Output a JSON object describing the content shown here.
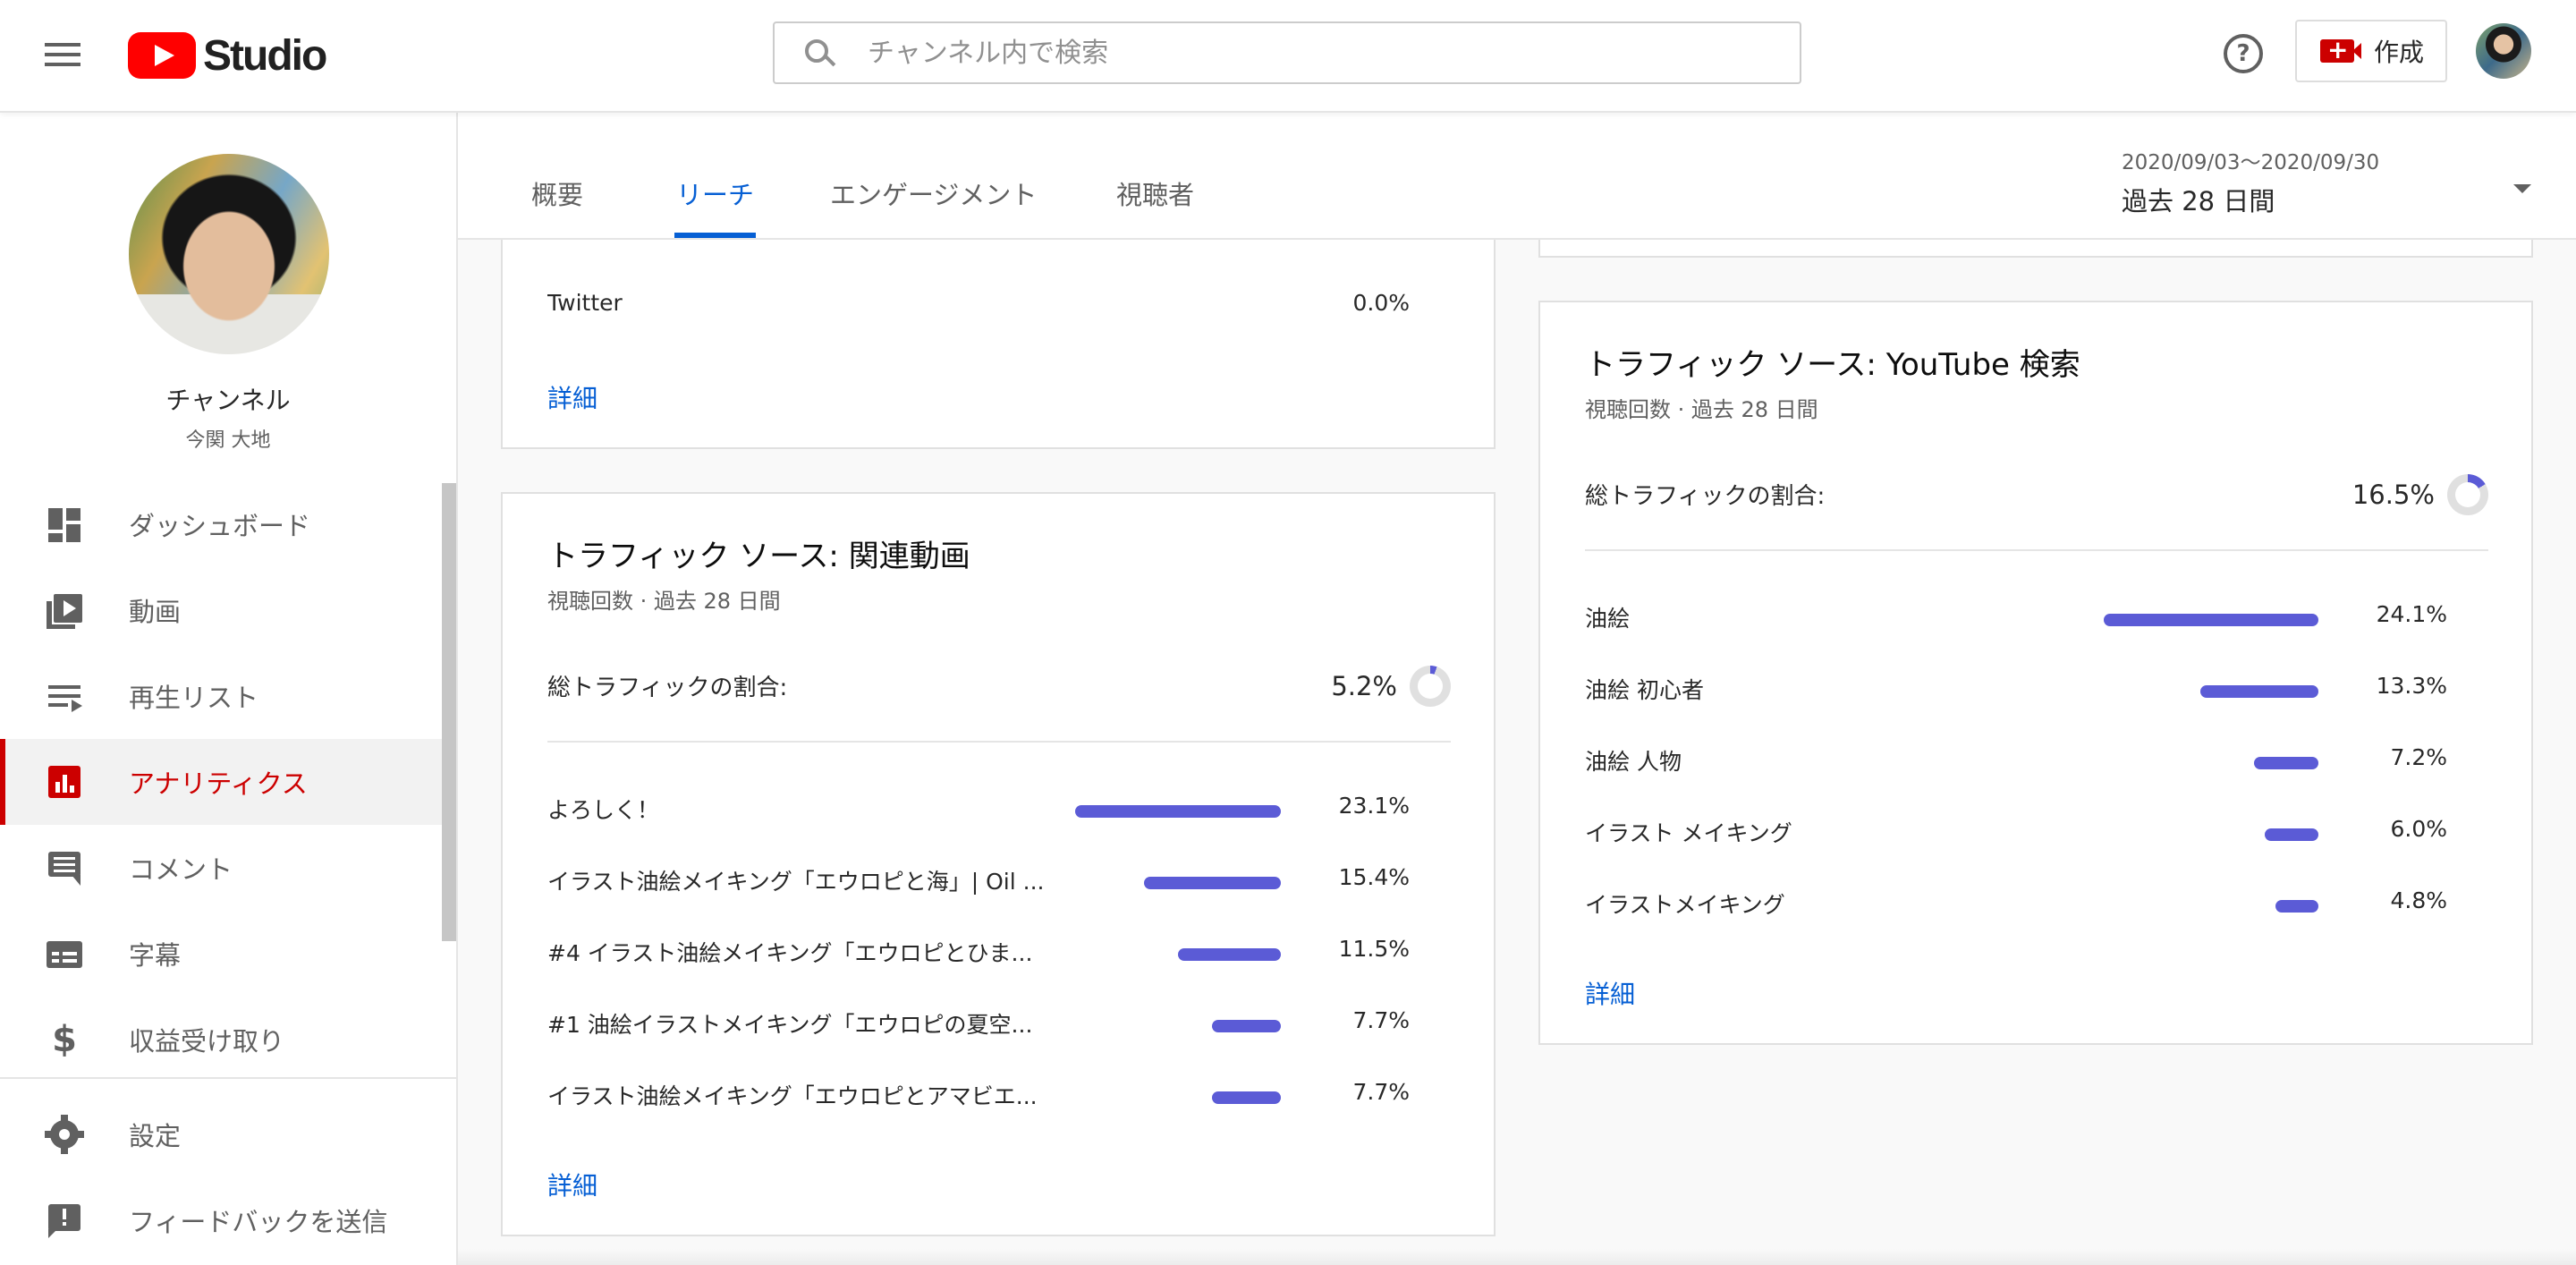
{
  "header": {
    "logo_text": "Studio",
    "search_placeholder": "チャンネル内で検索",
    "help_label": "?",
    "create_label": "作成"
  },
  "channel": {
    "title": "チャンネル",
    "name": "今関 大地"
  },
  "sidebar": {
    "items": [
      {
        "label": "ダッシュボード",
        "icon": "dashboard-icon"
      },
      {
        "label": "動画",
        "icon": "video-icon"
      },
      {
        "label": "再生リスト",
        "icon": "playlist-icon"
      },
      {
        "label": "アナリティクス",
        "icon": "analytics-icon",
        "active": true
      },
      {
        "label": "コメント",
        "icon": "comment-icon"
      },
      {
        "label": "字幕",
        "icon": "subtitles-icon"
      },
      {
        "label": "収益受け取り",
        "icon": "dollar-icon"
      },
      {
        "label": "設定",
        "icon": "gear-icon"
      },
      {
        "label": "フィードバックを送信",
        "icon": "feedback-icon"
      }
    ],
    "money_glyph": "$"
  },
  "tabs": [
    "概要",
    "リーチ",
    "エンゲージメント",
    "視聴者"
  ],
  "active_tab": "リーチ",
  "date": {
    "range": "2020/09/03〜2020/09/30",
    "label": "過去 28 日間"
  },
  "accent_color": "#065fd4",
  "bar_color": "#5b5bd6",
  "top_card": {
    "row_label": "Twitter",
    "row_pct": "0.0%",
    "link": "詳細"
  },
  "related_card": {
    "title": "トラフィック ソース: 関連動画",
    "subtitle": "視聴回数 · 過去 28 日間",
    "total_label": "総トラフィックの割合:",
    "total_value": "5.2%",
    "total_fraction": 0.052,
    "rows": [
      {
        "label": "よろしく！",
        "pct": "23.1%",
        "value": 23.1
      },
      {
        "label": "イラスト油絵メイキング「エウロピと海」| Oil ...",
        "pct": "15.4%",
        "value": 15.4
      },
      {
        "label": "#4 イラスト油絵メイキング「エウロピとひま...",
        "pct": "11.5%",
        "value": 11.5
      },
      {
        "label": "#1 油絵イラストメイキング「エウロピの夏空...",
        "pct": "7.7%",
        "value": 7.7
      },
      {
        "label": "イラスト油絵メイキング「エウロピとアマビエ...",
        "pct": "7.7%",
        "value": 7.7
      }
    ],
    "link": "詳細"
  },
  "search_card": {
    "title": "トラフィック ソース: YouTube 検索",
    "subtitle": "視聴回数 · 過去 28 日間",
    "total_label": "総トラフィックの割合:",
    "total_value": "16.5%",
    "total_fraction": 0.165,
    "rows": [
      {
        "label": "油絵",
        "pct": "24.1%",
        "value": 24.1
      },
      {
        "label": "油絵 初心者",
        "pct": "13.3%",
        "value": 13.3
      },
      {
        "label": "油絵 人物",
        "pct": "7.2%",
        "value": 7.2
      },
      {
        "label": "イラスト メイキング",
        "pct": "6.0%",
        "value": 6.0
      },
      {
        "label": "イラストメイキング",
        "pct": "4.8%",
        "value": 4.8
      }
    ],
    "link": "詳細"
  }
}
